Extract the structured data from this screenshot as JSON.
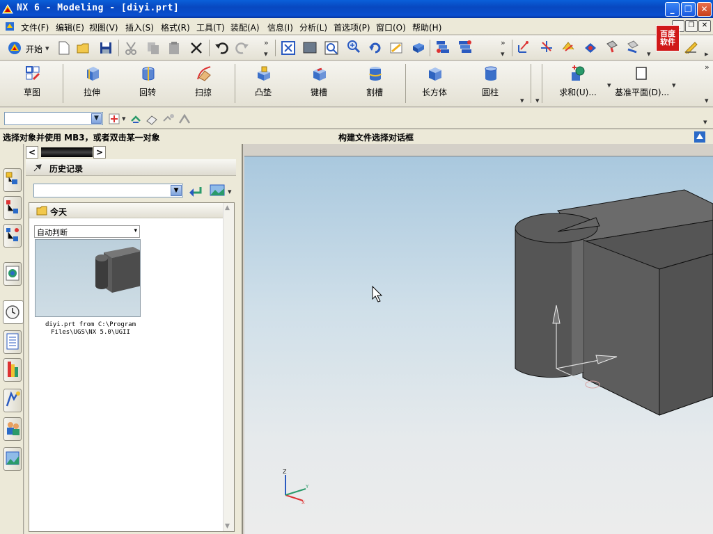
{
  "window": {
    "title": "NX 6 - Modeling - [diyi.prt]"
  },
  "menubar": {
    "items": [
      "文件(F)",
      "编辑(E)",
      "视图(V)",
      "插入(S)",
      "格式(R)",
      "工具(T)",
      "装配(A)",
      "信息(I)",
      "分析(L)",
      "首选项(P)",
      "窗口(O)",
      "帮助(H)"
    ]
  },
  "toolbar": {
    "start_label": "开始"
  },
  "features": {
    "items": [
      "草图",
      "拉伸",
      "回转",
      "扫掠",
      "凸垫",
      "键槽",
      "割槽",
      "长方体",
      "圆柱",
      "求和(U)...",
      "基准平面(D)..."
    ]
  },
  "status": {
    "prompt": "选择对象并使用 MB3，或者双击某一对象",
    "message": "构建文件选择对话框"
  },
  "history_panel": {
    "title": "历史记录",
    "group": "今天",
    "view_select": "自动判断",
    "file_caption_line1": "diyi.prt from C:\\Program",
    "file_caption_line2": "Files\\UGS\\NX 5.0\\UGII"
  },
  "badge": {
    "line1": "百度",
    "line2": "软件"
  },
  "colors": {
    "titlebar": "#0a4fd0",
    "viewport_top": "#a9c8de",
    "viewport_bottom": "#ececec",
    "model": "#5b5b5b"
  },
  "triad": {
    "z": "Z",
    "y": "Y",
    "x": "X"
  }
}
